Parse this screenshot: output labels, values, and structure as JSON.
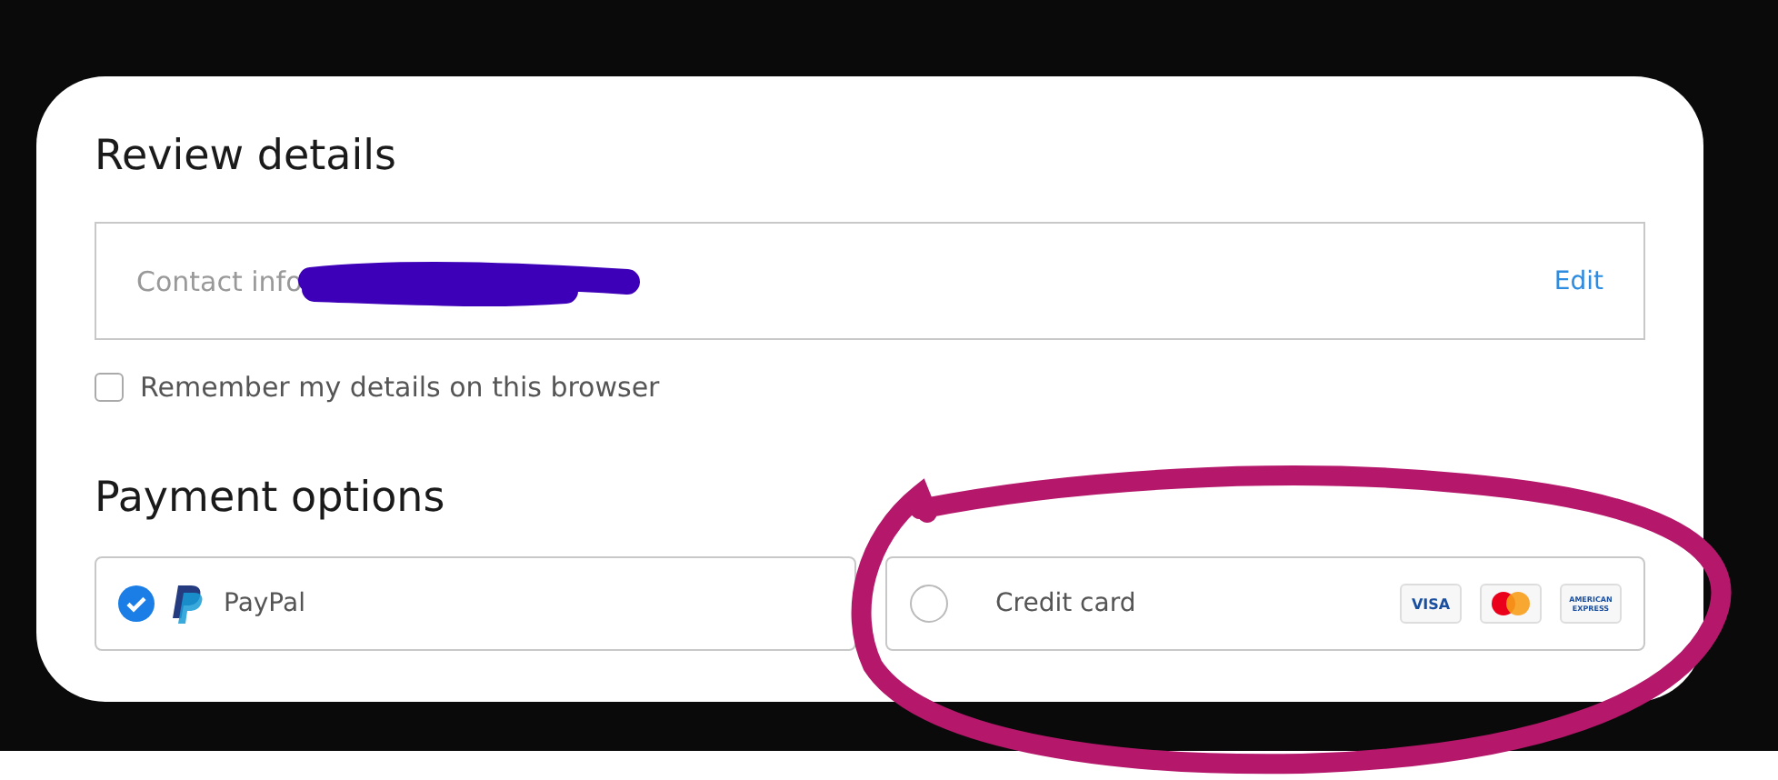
{
  "review": {
    "title": "Review details",
    "contact": {
      "label": "Contact info",
      "redacted": true,
      "action": "Edit"
    },
    "remember": {
      "label": "Remember my details on this browser",
      "checked": false
    }
  },
  "payment": {
    "title": "Payment options",
    "options": [
      {
        "kind": "paypal",
        "label": "PayPal",
        "selected": true
      },
      {
        "kind": "card",
        "label": "Credit card",
        "selected": false,
        "brands": [
          {
            "kind": "visa",
            "text": "VISA"
          },
          {
            "kind": "mastercard"
          },
          {
            "kind": "amex",
            "text": "AMERICAN EXPRESS"
          }
        ]
      }
    ]
  },
  "annotation": {
    "kind": "circle",
    "color": "#b5176a"
  }
}
